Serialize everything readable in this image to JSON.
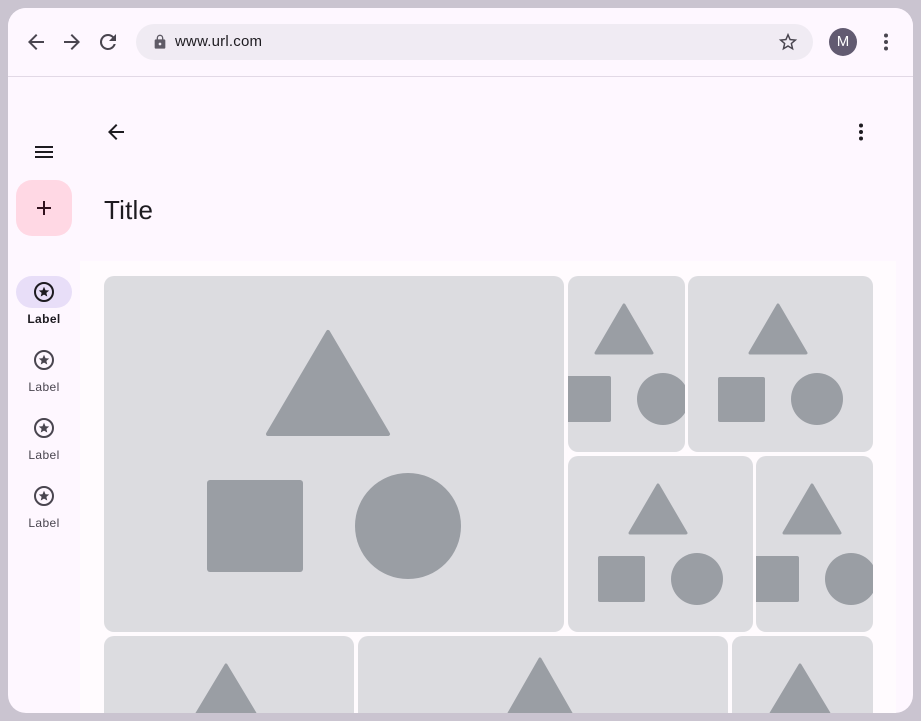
{
  "browser": {
    "url": "www.url.com",
    "avatar_initial": "M",
    "icons": [
      "back-arrow-icon",
      "forward-arrow-icon",
      "reload-icon",
      "lock-icon",
      "star-outline-icon",
      "more-vert-icon"
    ]
  },
  "rail": {
    "menu_icon": "menu-icon",
    "fab_icon": "add-icon",
    "items": [
      {
        "label": "Label",
        "icon": "star-circle-icon",
        "active": true
      },
      {
        "label": "Label",
        "icon": "star-circle-icon",
        "active": false
      },
      {
        "label": "Label",
        "icon": "star-circle-icon",
        "active": false
      },
      {
        "label": "Label",
        "icon": "star-circle-icon",
        "active": false
      }
    ]
  },
  "app_bar": {
    "title": "Title",
    "back_icon": "back-arrow-icon",
    "more_icon": "more-vert-icon"
  },
  "gallery": {
    "tile_count": 8,
    "placeholder_icon": "shapes-placeholder-icon"
  },
  "colors": {
    "surface": "#fef7ff",
    "fab": "#ffd8e4",
    "active_indicator": "#e8def8",
    "tile_bg": "#dcdce0",
    "shape_fill": "#9a9ea4",
    "frame": "#cac4d0"
  }
}
